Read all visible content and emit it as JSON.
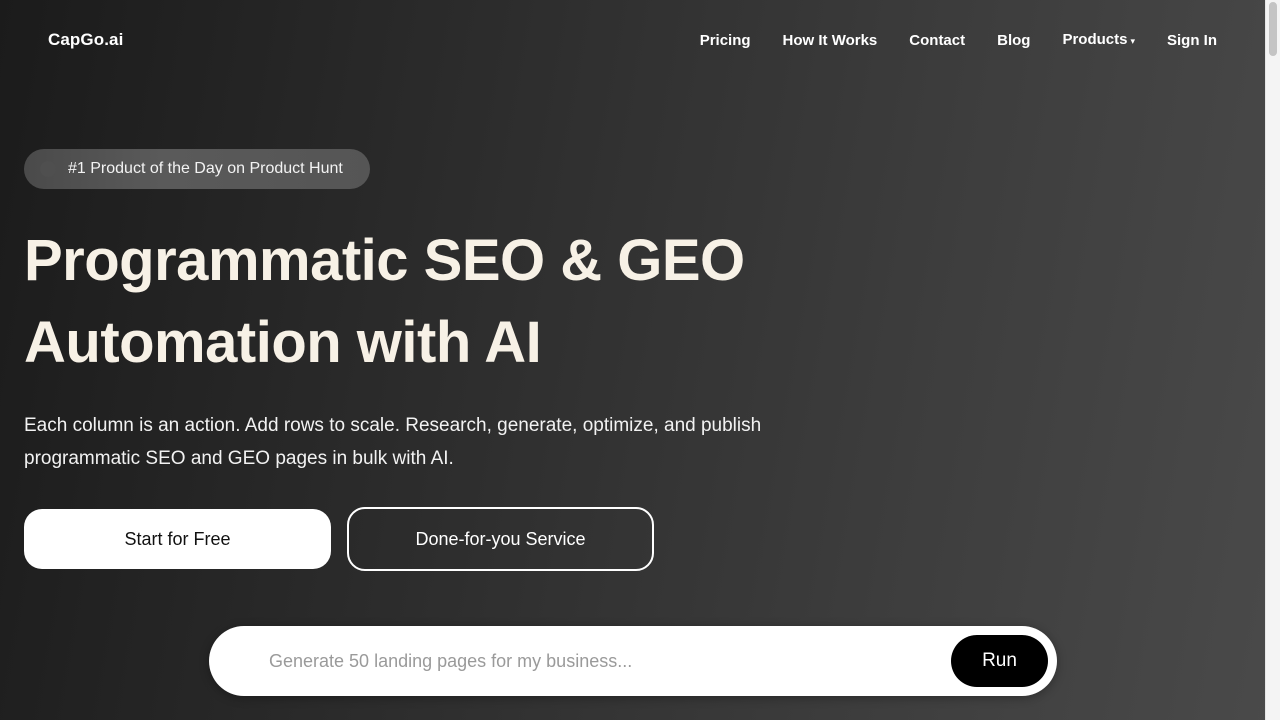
{
  "header": {
    "logo": "CapGo.ai",
    "nav": [
      {
        "label": "Pricing"
      },
      {
        "label": "How It Works"
      },
      {
        "label": "Contact"
      },
      {
        "label": "Blog"
      },
      {
        "label": "Products",
        "icon": "chevron-down-icon",
        "caret": "▾"
      },
      {
        "label": "Sign In"
      }
    ]
  },
  "hero": {
    "badge_text": "#1 Product of the Day on Product Hunt",
    "title_line1": "Programmatic SEO & GEO",
    "title_line2": "Automation with AI",
    "subtitle": "Each column is an action. Add rows to scale. Research, generate, optimize, and publish programmatic SEO and GEO pages in bulk with AI.",
    "primary_cta": "Start for Free",
    "secondary_cta": "Done-for-you Service"
  },
  "prompt": {
    "placeholder": "Generate 50 landing pages for my business...",
    "value": "",
    "run_label": "Run"
  },
  "colors": {
    "title": "#f7f1e6",
    "primary_button_bg": "#ffffff",
    "run_button_bg": "#000000"
  }
}
